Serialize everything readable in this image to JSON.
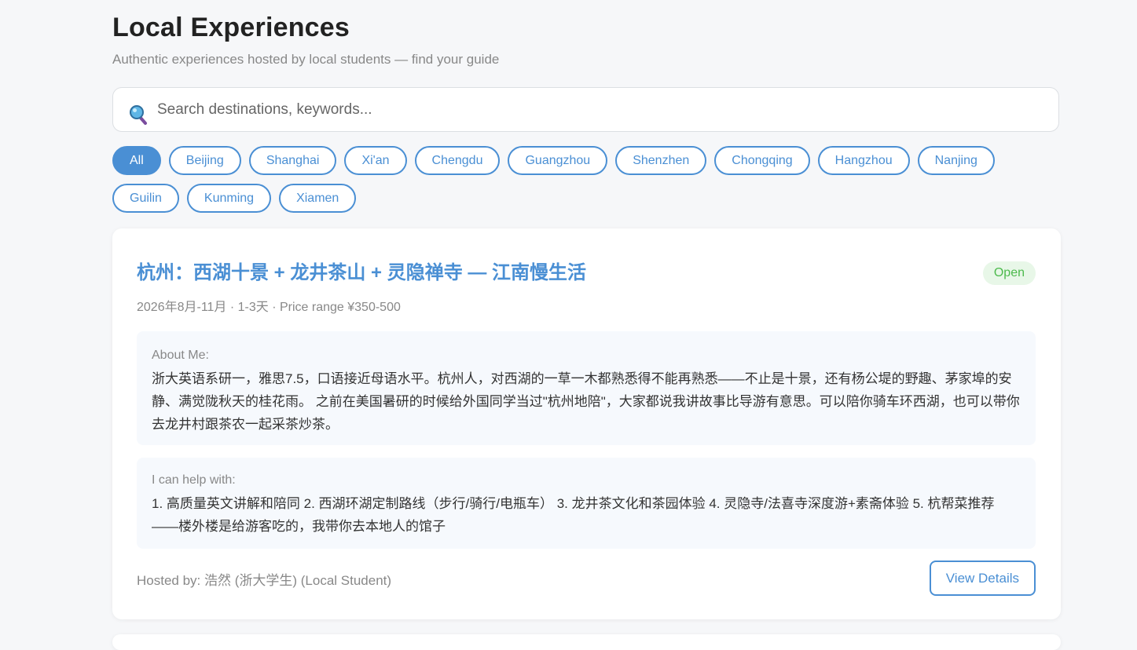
{
  "header": {
    "title": "Local Experiences",
    "subtitle": "Authentic experiences hosted by local students — find your guide"
  },
  "search": {
    "placeholder": "Search destinations, keywords...",
    "value": ""
  },
  "filters": {
    "selected": "All",
    "chips": [
      "All",
      "Beijing",
      "Shanghai",
      "Xi'an",
      "Chengdu",
      "Guangzhou",
      "Shenzhen",
      "Chongqing",
      "Hangzhou",
      "Nanjing",
      "Guilin",
      "Kunming",
      "Xiamen"
    ]
  },
  "experience": {
    "title": "杭州：西湖十景 + 龙井茶山 + 灵隐禅寺 — 江南慢生活",
    "status": "Open",
    "meta": "2026年8月-11月 · 1-3天 · Price range ¥350-500",
    "about_label": "About Me:",
    "about_text": "浙大英语系研一，雅思7.5，口语接近母语水平。杭州人，对西湖的一草一木都熟悉得不能再熟悉——不止是十景，还有杨公堤的野趣、茅家埠的安静、满觉陇秋天的桂花雨。 之前在美国暑研的时候给外国同学当过\"杭州地陪\"，大家都说我讲故事比导游有意思。可以陪你骑车环西湖，也可以带你去龙井村跟茶农一起采茶炒茶。",
    "help_label": "I can help with:",
    "help_text": "1. 高质量英文讲解和陪同 2. 西湖环湖定制路线（步行/骑行/电瓶车） 3. 龙井茶文化和茶园体验 4. 灵隐寺/法喜寺深度游+素斋体验 5. 杭帮菜推荐——楼外楼是给游客吃的，我带你去本地人的馆子",
    "host": "Hosted by: 浩然 (浙大学生) (Local Student)",
    "view_button": "View Details"
  },
  "colors": {
    "accent": "#4a8fd4",
    "status_green": "#4cba4c",
    "status_bg": "#e8f7e8",
    "box_bg": "#f6f9fd"
  }
}
